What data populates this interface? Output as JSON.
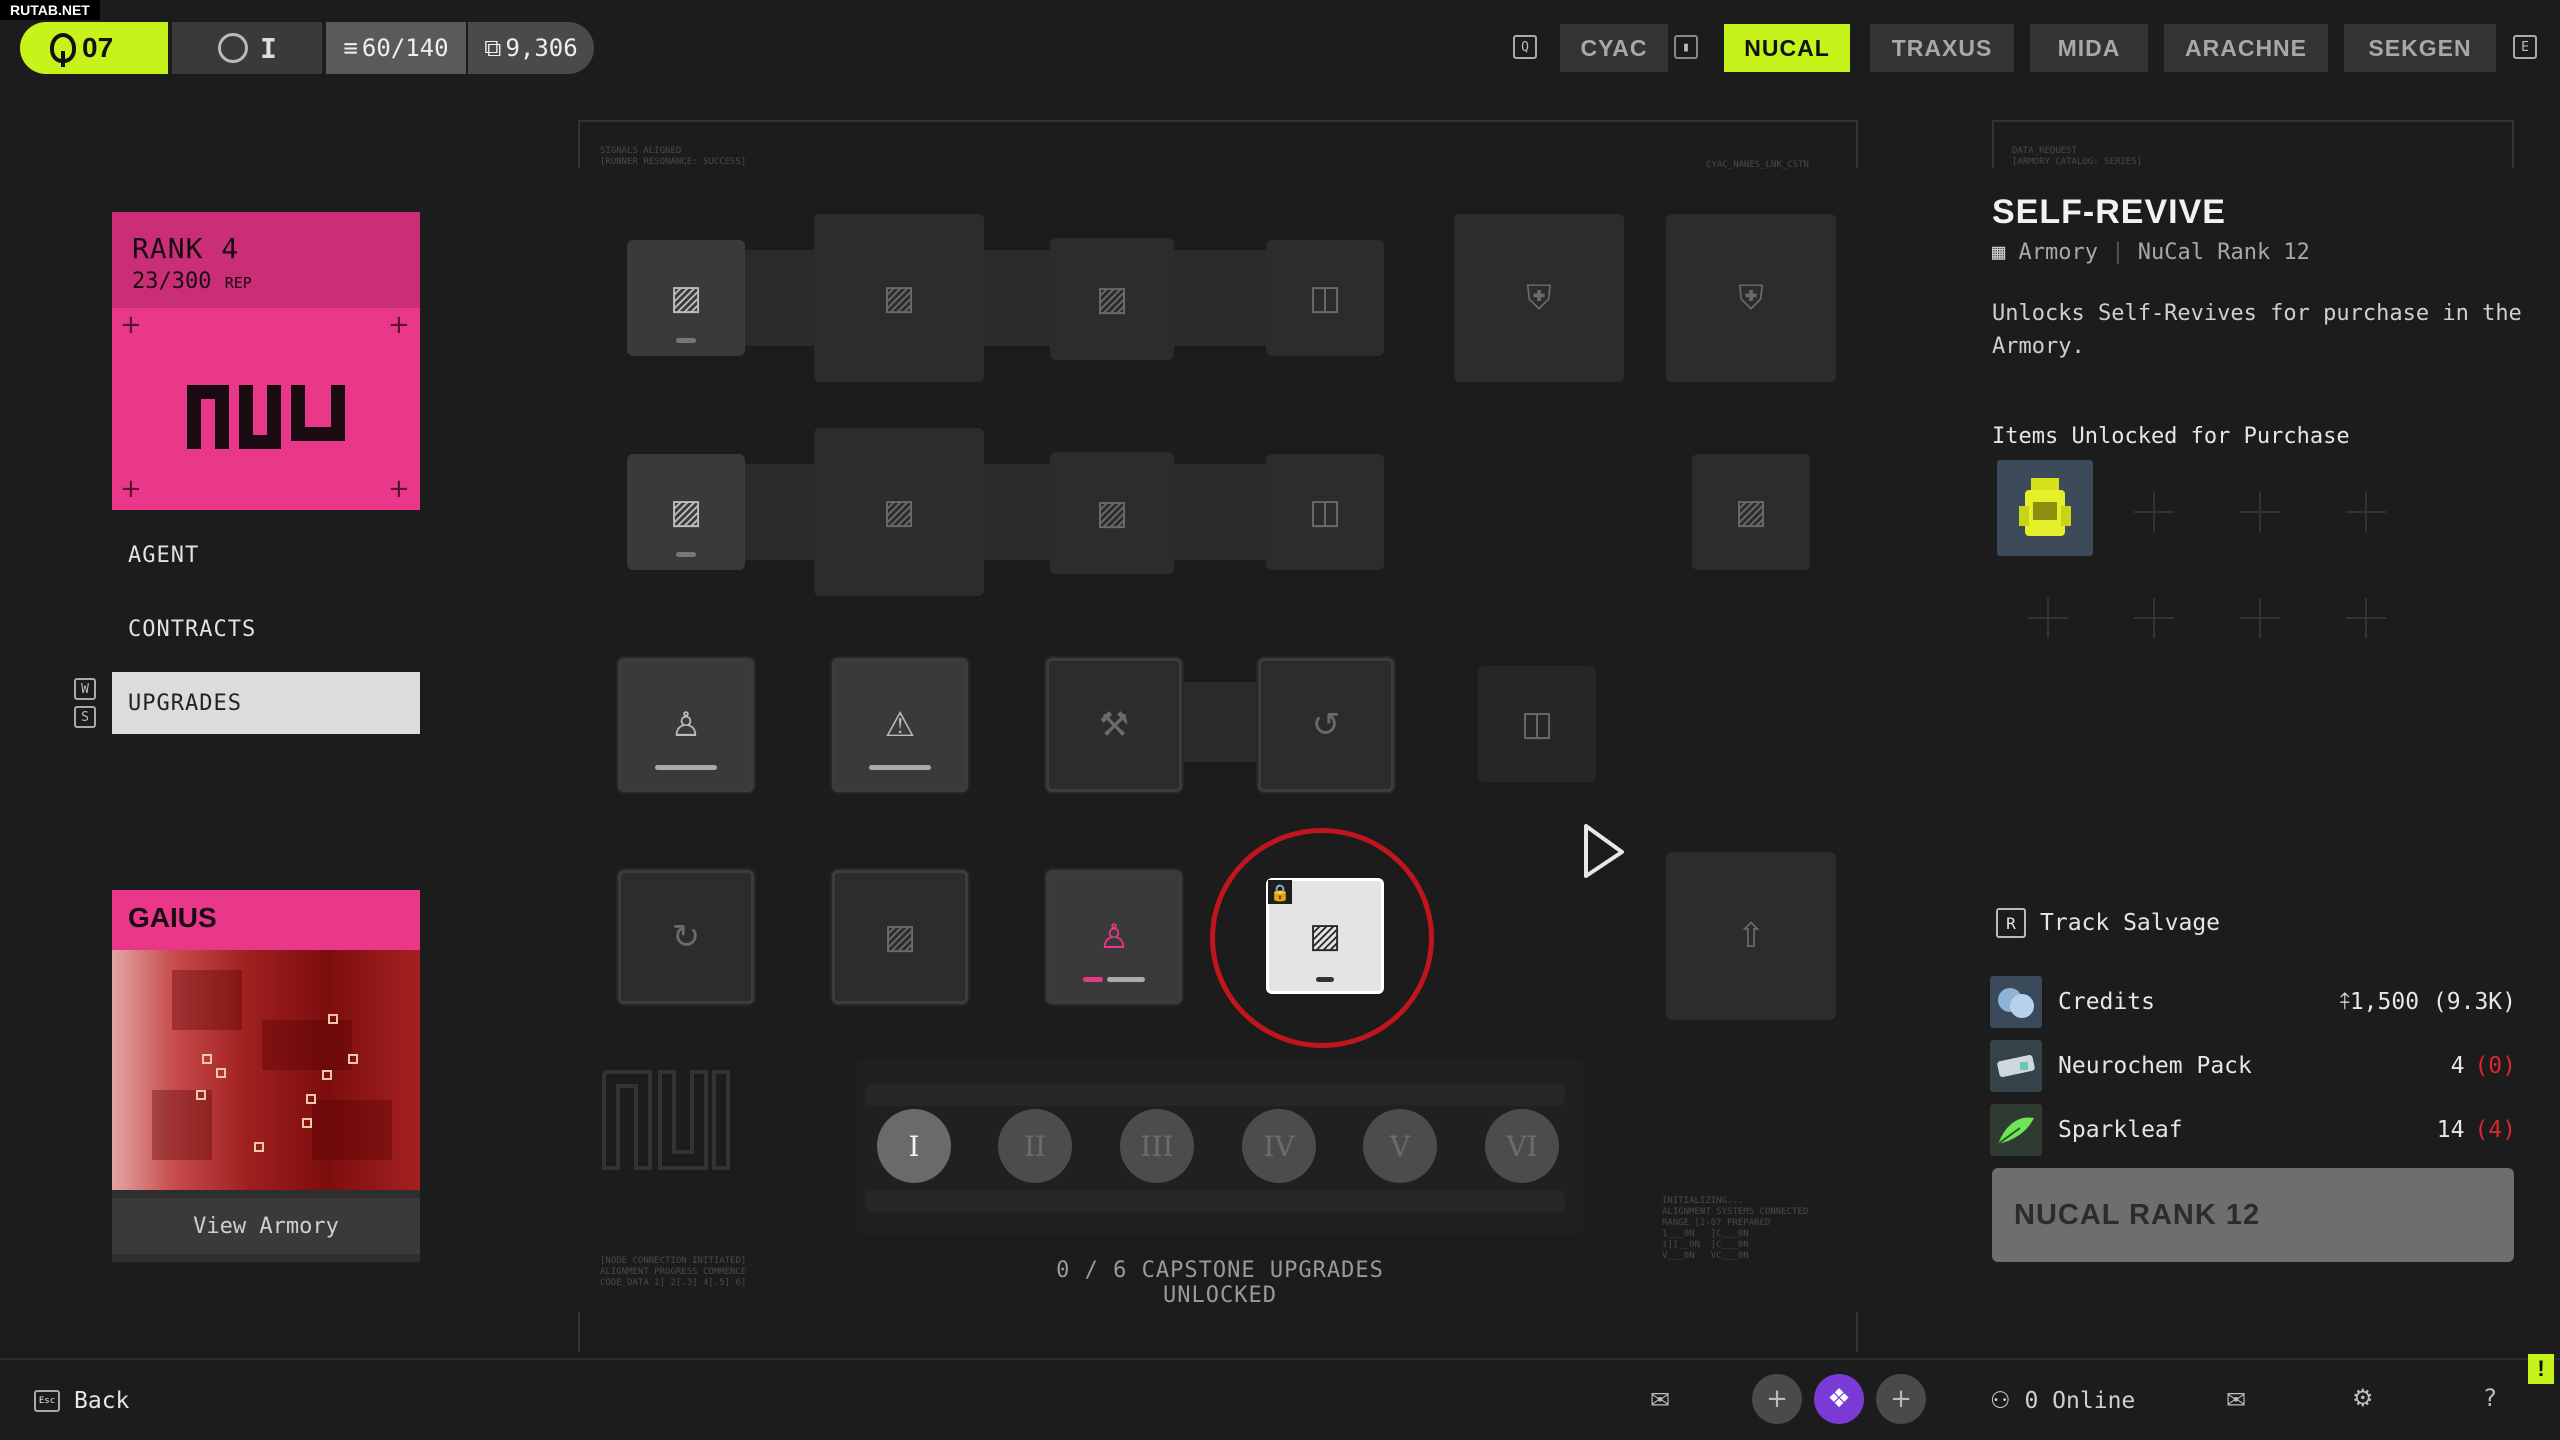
{
  "watermark": "RUTAB.NET",
  "topbar": {
    "level": "07",
    "prestige": "I",
    "capacity": "60/140",
    "credits": "9,306",
    "key_left": "Q",
    "key_right": "E",
    "factions": [
      "CYAC",
      "NUCAL",
      "TRAXUS",
      "MIDA",
      "ARACHNE",
      "SEKGEN"
    ],
    "active_faction": "NUCAL"
  },
  "rank_card": {
    "rank": "RANK 4",
    "rep_value": "23/300",
    "rep_unit": "REP"
  },
  "nav": {
    "items": [
      "AGENT",
      "CONTRACTS",
      "UPGRADES"
    ],
    "selected": "UPGRADES",
    "key_up": "W",
    "key_down": "S"
  },
  "handler": {
    "name": "GAIUS",
    "button": "View Armory"
  },
  "upgrade_tree": {
    "capstones": [
      "I",
      "II",
      "III",
      "IV",
      "V",
      "VI"
    ],
    "capstone_active": "I",
    "caption": "0 / 6 CAPSTONE UPGRADES UNLOCKED",
    "tiny_left_top": "SIGNALS ALIGNED\n[RUNNER RESONANCE: SUCCESS]",
    "tiny_right_top": "CYAC_NANES_LNK_CSTN",
    "tiny_left_bottom": "[NODE CONNECTION INITIATED]\nALIGNMENT PROGRESS COMMENCE\nCODE_DATA 1] 2[.3] 4[.5] 6]",
    "tiny_right_bottom": "INITIALIZING...\nALIGNMENT SYSTEMS CONNECTED\nRANGE [1-07 PREPARED\n1___0N   ]C___0N\n1]]__0N  ]C___0N\nV___0N   VC___0N"
  },
  "detail": {
    "tiny_header": "DATA_REQUEST\n[ARMORY CATALOG: SERIES]",
    "title": "SELF-REVIVE",
    "source": "Armory",
    "requirement": "NuCal Rank 12",
    "description": "Unlocks Self-Revives for purchase in the Armory.",
    "items_heading": "Items Unlocked for Purchase",
    "track_key": "R",
    "track_label": "Track Salvage",
    "salvage": [
      {
        "name": "Credits",
        "value": "⤉1,500 (9.3K)",
        "deficit": ""
      },
      {
        "name": "Neurochem Pack",
        "value": "4",
        "deficit": "(0)"
      },
      {
        "name": "Sparkleaf",
        "value": "14",
        "deficit": "(4)"
      }
    ],
    "unlock_button": "NUCAL RANK 12"
  },
  "bottombar": {
    "back_key": "Esc",
    "back_label": "Back",
    "online": "0 Online"
  },
  "colors": {
    "accent": "#c6f31a",
    "nucal_pink": "#e9378a",
    "deficit_red": "#d8272d",
    "focus_ring": "#c0151c"
  }
}
